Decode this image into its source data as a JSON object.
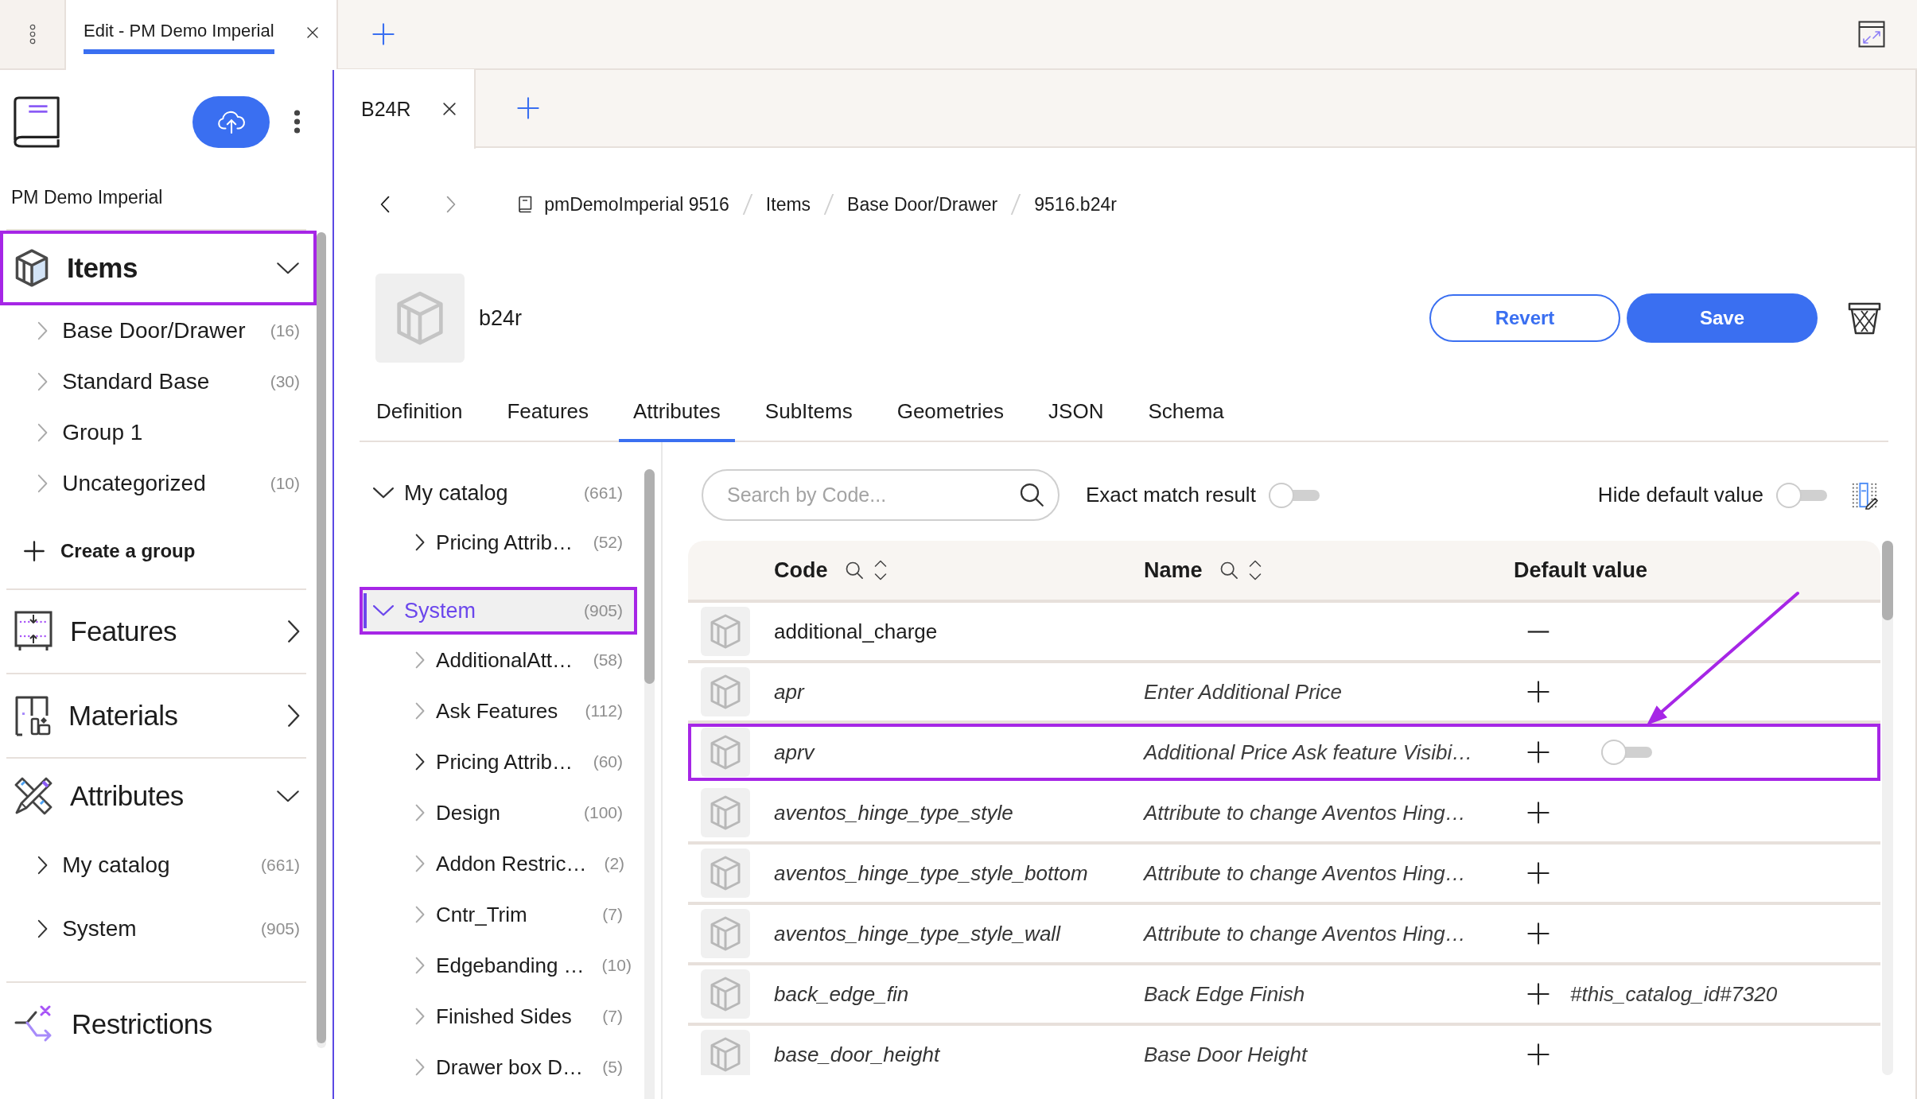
{
  "app_tabs": [
    {
      "label": "Edit - PM Demo Imperial",
      "selected": true
    }
  ],
  "sidebar": {
    "catalog_name": "PM Demo Imperial",
    "sections": [
      {
        "kind": "items",
        "label": "Items",
        "selected": true,
        "expanded": true,
        "annotated": true,
        "groups": [
          {
            "label": "Base Door/Drawer",
            "count": "(16)",
            "expandable": false,
            "selected": false
          },
          {
            "label": "Standard Base",
            "count": "(30)",
            "expandable": false,
            "selected": false
          },
          {
            "label": "Group 1",
            "expandable": false,
            "selected": false
          },
          {
            "label": "Uncategorized",
            "count": "(10)",
            "expandable": false,
            "selected": false
          }
        ],
        "action": "Create a group"
      },
      {
        "kind": "features",
        "label": "Features",
        "selected": false,
        "expanded": false,
        "annotated": false
      },
      {
        "kind": "materials",
        "label": "Materials",
        "selected": false,
        "expanded": false,
        "annotated": false
      },
      {
        "kind": "attributes",
        "label": "Attributes",
        "selected": false,
        "expanded": true,
        "annotated": false,
        "groups": [
          {
            "label": "My catalog",
            "count": "(661)",
            "expandable": true,
            "selected": false
          },
          {
            "label": "System",
            "count": "(905)",
            "expandable": true,
            "selected": false
          }
        ]
      },
      {
        "kind": "restrictions",
        "label": "Restrictions",
        "selected": false,
        "annotated": false
      }
    ]
  },
  "document_tabs": [
    {
      "label": "B24R",
      "selected": true
    }
  ],
  "breadcrumb": [
    "pmDemoImperial 9516",
    "Items",
    "Base Door/Drawer",
    "9516.b24r"
  ],
  "item": {
    "title": "b24r"
  },
  "actions": {
    "revert": "Revert",
    "save": "Save"
  },
  "tabs": [
    {
      "label": "Definition",
      "selected": false
    },
    {
      "label": "Features",
      "selected": false
    },
    {
      "label": "Attributes",
      "selected": true
    },
    {
      "label": "SubItems",
      "selected": false
    },
    {
      "label": "Geometries",
      "selected": false
    },
    {
      "label": "JSON",
      "selected": false
    },
    {
      "label": "Schema",
      "selected": false
    }
  ],
  "tree": [
    {
      "label": "My catalog",
      "count": "(661)",
      "expanded": true,
      "selected": false,
      "annotated": false,
      "children": [
        {
          "label": "Pricing Attrib…",
          "count": "(52)",
          "expandable": true,
          "selected": false
        }
      ]
    },
    {
      "label": "System",
      "count": "(905)",
      "expanded": true,
      "selected": true,
      "annotated": true,
      "children": [
        {
          "label": "AdditionalAtt…",
          "count": "(58)",
          "expandable": false,
          "selected": false
        },
        {
          "label": "Ask Features",
          "count": "(112)",
          "expandable": false,
          "selected": false
        },
        {
          "label": "Pricing Attrib…",
          "count": "(60)",
          "expandable": true,
          "selected": false
        },
        {
          "label": "Design",
          "count": "(100)",
          "expandable": false,
          "selected": false
        },
        {
          "label": "Addon Restric…",
          "count": "(2)",
          "expandable": false,
          "selected": false
        },
        {
          "label": "Cntr_Trim",
          "count": "(7)",
          "expandable": false,
          "selected": false
        },
        {
          "label": "Edgebanding …",
          "count": "(10)",
          "expandable": false,
          "selected": false
        },
        {
          "label": "Finished Sides",
          "count": "(7)",
          "expandable": false,
          "selected": false
        },
        {
          "label": "Drawer box D…",
          "count": "(5)",
          "expandable": false,
          "selected": false
        }
      ]
    }
  ],
  "filters": {
    "search": {
      "placeholder": "Search by Code..."
    },
    "exact_match": {
      "label": "Exact match result",
      "on": false
    },
    "hide_default": {
      "label": "Hide default value",
      "on": false
    }
  },
  "table": {
    "columns": [
      {
        "label": "Code",
        "searchable": true,
        "sortable": true
      },
      {
        "label": "Name",
        "searchable": true,
        "sortable": true
      },
      {
        "label": "Default value",
        "searchable": false,
        "sortable": false
      }
    ],
    "rows": [
      {
        "code": "additional_charge",
        "inherited": false,
        "expanded": true,
        "annotated": false
      },
      {
        "code": "apr",
        "name": "Enter Additional Price",
        "inherited": true,
        "expanded": false,
        "annotated": false
      },
      {
        "code": "aprv",
        "name": "Additional Price Ask feature Visibi…",
        "inherited": true,
        "expanded": false,
        "annotated": true,
        "default_value": {
          "kind": "toggle",
          "on": false
        }
      },
      {
        "code": "aventos_hinge_type_style",
        "name": "Attribute to change Aventos Hing…",
        "inherited": true,
        "expanded": false,
        "annotated": false
      },
      {
        "code": "aventos_hinge_type_style_bottom",
        "name": "Attribute to change Aventos Hing…",
        "inherited": true,
        "expanded": false,
        "annotated": false
      },
      {
        "code": "aventos_hinge_type_style_wall",
        "name": "Attribute to change Aventos Hing…",
        "inherited": true,
        "expanded": false,
        "annotated": false
      },
      {
        "code": "back_edge_fin",
        "name": "Back Edge Finish",
        "inherited": true,
        "expanded": false,
        "annotated": false,
        "default_value": {
          "kind": "text",
          "text": "#this_catalog_id#7320"
        }
      },
      {
        "code": "base_door_height",
        "name": "Base Door Height",
        "inherited": true,
        "expanded": false,
        "annotated": false
      }
    ]
  },
  "annotation_arrow": true
}
